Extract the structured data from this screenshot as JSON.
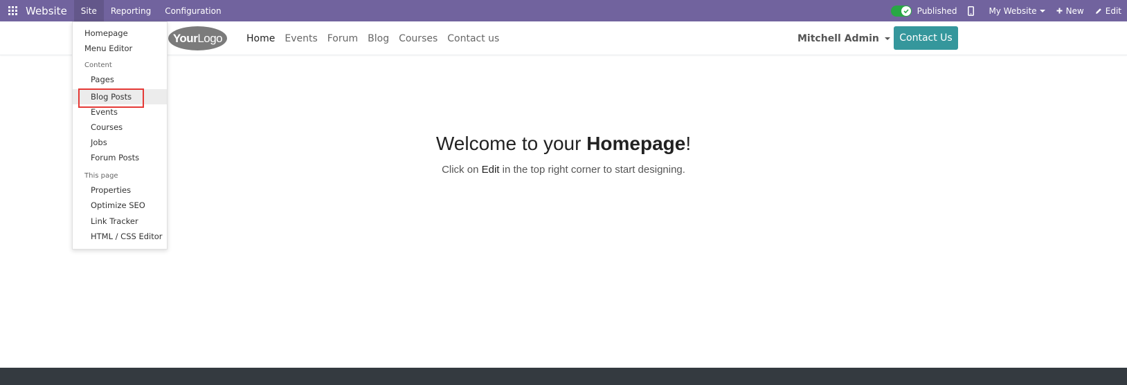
{
  "topbar": {
    "app_name": "Website",
    "menu": [
      {
        "label": "Site"
      },
      {
        "label": "Reporting"
      },
      {
        "label": "Configuration"
      }
    ],
    "published_label": "Published",
    "website_selector": "My Website",
    "new_label": "New",
    "edit_label": "Edit",
    "bar_color": "#71639e"
  },
  "header": {
    "logo_bold": "Your",
    "logo_rest": "Logo",
    "nav": [
      {
        "label": "Home"
      },
      {
        "label": "Events"
      },
      {
        "label": "Forum"
      },
      {
        "label": "Blog"
      },
      {
        "label": "Courses"
      },
      {
        "label": "Contact us"
      }
    ],
    "active_nav": "Home",
    "user_name": "Mitchell Admin",
    "cta_label": "Contact Us",
    "cta_color": "#35979c"
  },
  "site_menu": {
    "top_items": [
      "Homepage",
      "Menu Editor"
    ],
    "content_header": "Content",
    "content_items": [
      "Pages",
      "Blog Posts",
      "Events",
      "Courses",
      "Jobs",
      "Forum Posts"
    ],
    "page_header": "This page",
    "page_items": [
      "Properties",
      "Optimize SEO",
      "Link Tracker",
      "HTML / CSS Editor"
    ],
    "highlighted_item": "Blog Posts",
    "highlight_color": "#e53935"
  },
  "main": {
    "welcome_prefix": "Welcome to your ",
    "welcome_bold": "Homepage",
    "welcome_suffix": "!",
    "sub_prefix": "Click on ",
    "sub_em": "Edit",
    "sub_suffix": " in the top right corner to start designing."
  }
}
